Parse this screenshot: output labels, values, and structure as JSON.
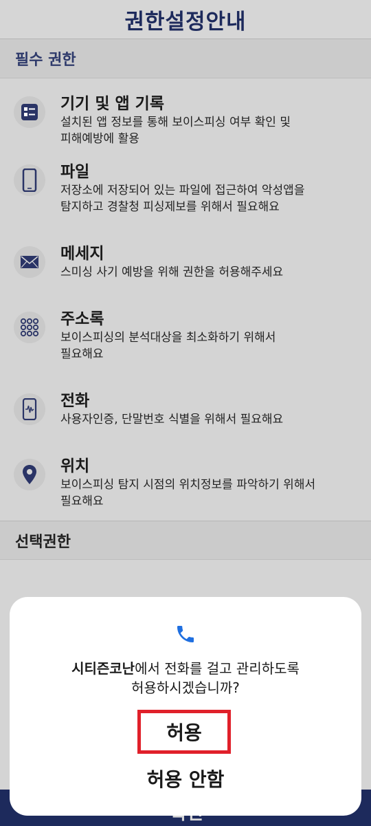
{
  "header": {
    "title": "권한설정안내"
  },
  "sections": {
    "required_label": "필수 권한",
    "optional_label": "선택권한"
  },
  "permissions": [
    {
      "icon": "list-icon",
      "title": "기기 및 앱 기록",
      "desc": [
        "설치된 앱 정보를 통해 보이스피싱 여부 확인 및",
        "피해예방에 활용"
      ]
    },
    {
      "icon": "phone-device-icon",
      "title": "파일",
      "desc": [
        "저장소에 저장되어 있는 파일에 접근하여 악성앱을",
        "탐지하고 경찰청 피싱제보를 위해서 필요해요"
      ]
    },
    {
      "icon": "envelope-icon",
      "title": "메세지",
      "desc": [
        "스미싱 사기 예방을 위해 권한을 허용해주세요"
      ]
    },
    {
      "icon": "dialpad-icon",
      "title": "주소록",
      "desc": [
        "보이스피싱의 분석대상을 최소화하기 위해서",
        "필요해요"
      ]
    },
    {
      "icon": "phone-waveform-icon",
      "title": "전화",
      "desc": [
        "사용자인증, 단말번호 식별을 위해서 필요해요"
      ]
    },
    {
      "icon": "location-pin-icon",
      "title": "위치",
      "desc": [
        "보이스피싱 탐지 시점의 위치정보를 파악하기 위해서",
        "필요해요"
      ]
    }
  ],
  "bottom_bar": {
    "label": "확인"
  },
  "dialog": {
    "icon": "phone-icon",
    "app_name": "시티즌코난",
    "message_rest": "에서 전화를 걸고 관리하도록",
    "message_line2": "허용하시겠습니까?",
    "allow_label": "허용",
    "deny_label": "허용 안함"
  },
  "colors": {
    "navy": "#1d2a5c",
    "highlight": "#e0202a",
    "phone_blue": "#1f6fe0"
  }
}
